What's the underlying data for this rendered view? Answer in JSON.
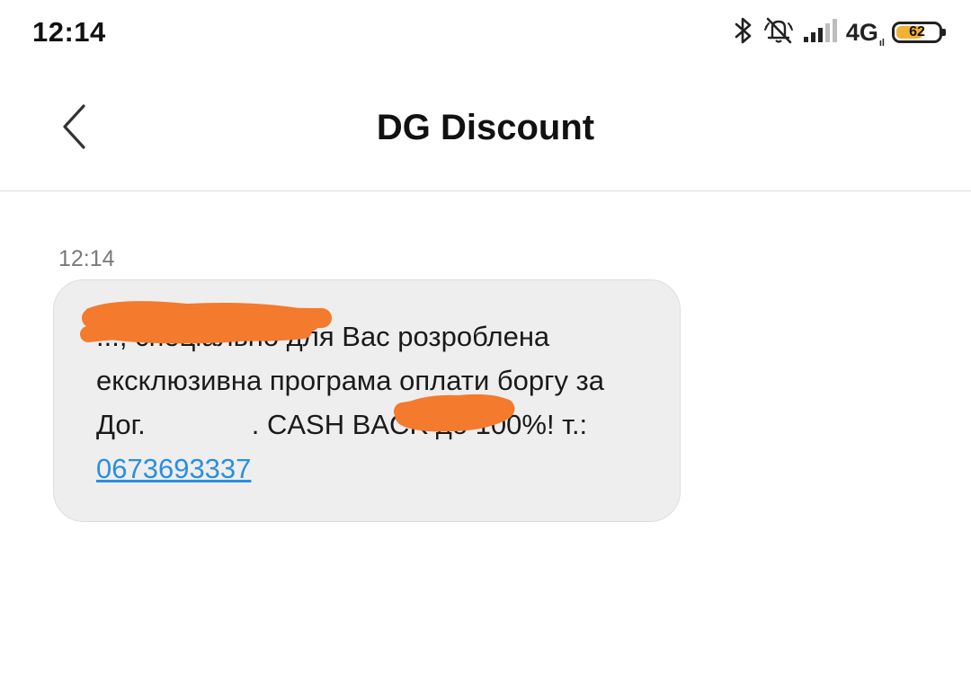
{
  "status_bar": {
    "time": "12:14",
    "network_type": "4G",
    "network_sub": "ıl",
    "battery_level": "62",
    "battery_fraction": 0.62,
    "icons": [
      "bluetooth-icon",
      "vibrate-off-icon",
      "signal-strength-icon"
    ]
  },
  "header": {
    "title": "DG Discount",
    "back_icon": "chevron-left-icon"
  },
  "conversation": {
    "messages": [
      {
        "time": "12:14",
        "text_part1": "..., спеціально для Вас розроблена ексклюзивна програма оплати боргу за Дог.",
        "text_part2": ". CASH BACK до 100%! т.: ",
        "phone": "0673693337",
        "redaction_color": "#f47a2e"
      }
    ]
  },
  "colors": {
    "bubble_background": "#eeeeee",
    "link": "#2a8fe0",
    "timestamp": "#7a7a7a",
    "battery_fill": "#f2b233"
  }
}
